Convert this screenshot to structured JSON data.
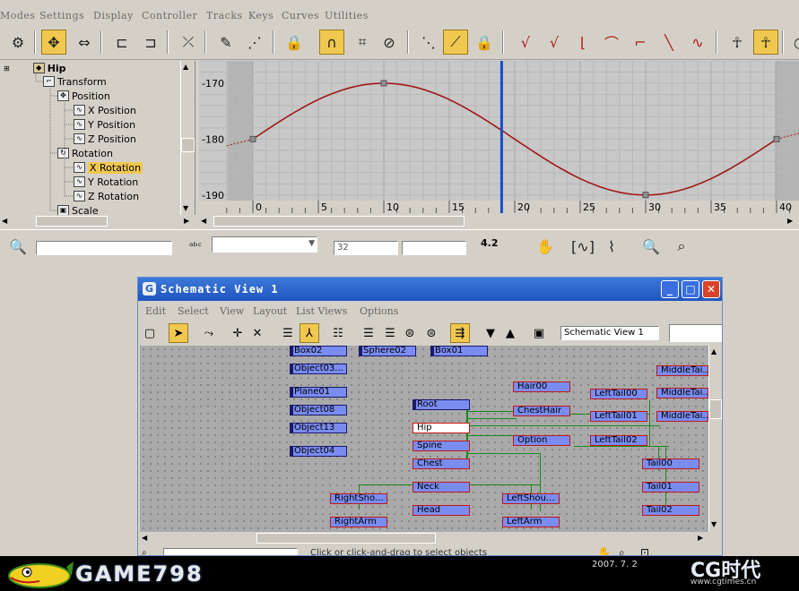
{
  "menu": [
    "Modes",
    "Settings",
    "Display",
    "Controller",
    "Tracks",
    "Keys",
    "Curves",
    "Utilities"
  ],
  "toolbar": {
    "icons": [
      "filter-icon",
      "move-keys-icon",
      "slide-keys-icon",
      "scale-keys-icon",
      "scale-values-icon",
      "add-keys-icon",
      "draw-curves-icon",
      "reduce-keys-icon",
      "lock-selection-icon",
      "snap-frames-icon",
      "show-tangents-icon",
      "no-tangents-icon",
      "show-all-tangents-icon",
      "lock-tangents-icon",
      "auto-tangent-icon",
      "custom-tangent-icon",
      "fast-tangent-icon",
      "slow-tangent-icon",
      "step-tangent-icon",
      "linear-tangent-icon",
      "smooth-tangent-icon",
      "parameter-curve-out-of-range-icon",
      "show-biped-icon"
    ]
  },
  "tree": {
    "items": [
      {
        "label": "Hip",
        "selected": false
      },
      {
        "label": "Transform",
        "selected": false
      },
      {
        "label": "Position",
        "selected": false
      },
      {
        "label": "X Position",
        "selected": false
      },
      {
        "label": "Y Position",
        "selected": false
      },
      {
        "label": "Z Position",
        "selected": false
      },
      {
        "label": "Rotation",
        "selected": false
      },
      {
        "label": "X Rotation",
        "selected": true
      },
      {
        "label": "Y Rotation",
        "selected": false
      },
      {
        "label": "Z Rotation",
        "selected": false
      },
      {
        "label": "Scale",
        "selected": false
      }
    ]
  },
  "curve": {
    "y_ticks": [
      "-170",
      "-180",
      "-190"
    ],
    "x_ticks": [
      "0",
      "5",
      "10",
      "15",
      "20",
      "25",
      "30",
      "35",
      "40"
    ],
    "curve_color": "#a01818",
    "time_marker_frame": 19
  },
  "status": {
    "frame_value": "32",
    "value_field": "",
    "zoom_value": "4.2"
  },
  "schematic": {
    "title": "Schematic View 1",
    "menu": [
      "Edit",
      "Select",
      "View",
      "Layout",
      "List Views",
      "Options"
    ],
    "view_name": "Schematic View 1",
    "prompt": "Click or click-and-drag to select objects",
    "nodes": {
      "box02": "Box02",
      "sphere02": "Sphere02",
      "box01": "Box01",
      "object03": "Object03...",
      "plane01": "Plane01",
      "object08": "Object08",
      "object13": "Object13",
      "object04": "Object04",
      "root": "Root",
      "hip": "Hip",
      "spine": "Spine",
      "chest": "Chest",
      "neck": "Neck",
      "head": "Head",
      "rightsho": "RightSho...",
      "rightarm": "RightArm",
      "hair00": "Hair00",
      "chesthair": "ChestHair",
      "option": "Option",
      "leftshou": "LeftShou...",
      "leftarm": "LeftArm",
      "lefttail00": "LeftTail00",
      "lefttail01": "LeftTail01",
      "lefttail02": "LeftTail02",
      "middletail1": "MiddleTai...",
      "middletail2": "MiddleTai...",
      "middletail3": "MiddleTai...",
      "tail00": "Tail00",
      "tail01": "Tail01",
      "tail02": "Tail02"
    }
  },
  "footer": {
    "logo": "GAME798",
    "date": "2007. 7. 2",
    "watermark": "CG时代",
    "url": "www.cgtimes.cn"
  }
}
